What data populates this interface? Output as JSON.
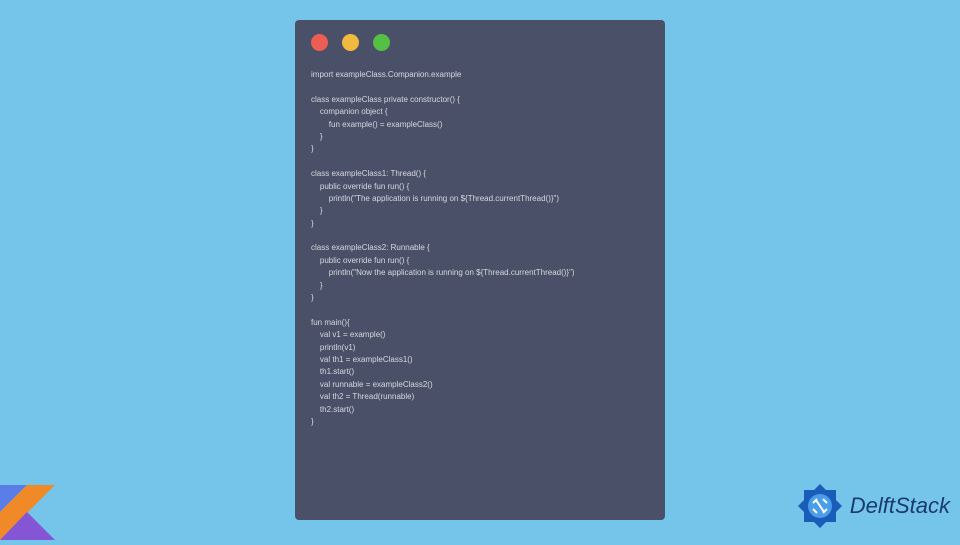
{
  "code": {
    "line1": "import exampleClass.Companion.example",
    "line2": "",
    "line3": "class exampleClass private constructor() {",
    "line4": "    companion object {",
    "line5": "        fun example() = exampleClass()",
    "line6": "    }",
    "line7": "}",
    "line8": "",
    "line9": "class exampleClass1: Thread() {",
    "line10": "    public override fun run() {",
    "line11": "        println(\"The application is running on ${Thread.currentThread()}\")",
    "line12": "    }",
    "line13": "}",
    "line14": "",
    "line15": "class exampleClass2: Runnable {",
    "line16": "    public override fun run() {",
    "line17": "        println(\"Now the application is running on ${Thread.currentThread()}\")",
    "line18": "    }",
    "line19": "}",
    "line20": "",
    "line21": "fun main(){",
    "line22": "    val v1 = example()",
    "line23": "    println(v1)",
    "line24": "    val th1 = exampleClass1()",
    "line25": "    th1.start()",
    "line26": "    val runnable = exampleClass2()",
    "line27": "    val th2 = Thread(runnable)",
    "line28": "    th2.start()",
    "line29": "}"
  },
  "brand": {
    "name": "DelftStack"
  }
}
